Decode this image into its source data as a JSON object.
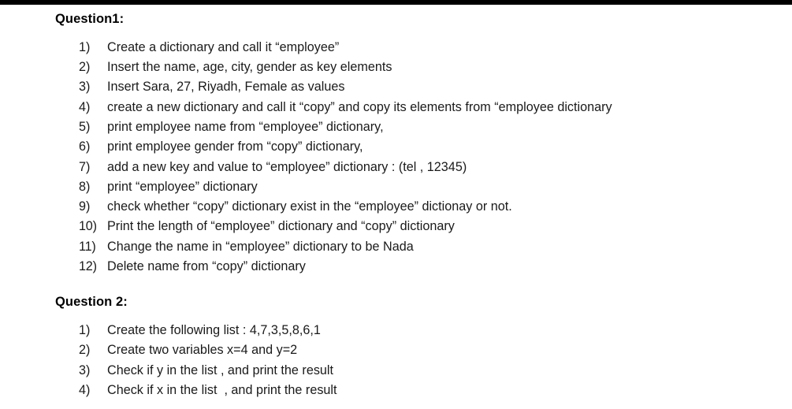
{
  "document": {
    "top_bar_color": "#000000",
    "background_color": "#ffffff",
    "text_color": "#1a1a1a"
  },
  "questions": [
    {
      "heading": "Question1:",
      "items": [
        {
          "marker": "1)",
          "text": "Create a dictionary and call it “employee”"
        },
        {
          "marker": "2)",
          "text": "Insert the name, age, city, gender as key elements"
        },
        {
          "marker": "3)",
          "text": "Insert Sara, 27, Riyadh, Female as values"
        },
        {
          "marker": "4)",
          "text": "create a new dictionary and call it “copy” and copy its elements from “employee dictionary"
        },
        {
          "marker": "5)",
          "text": "print employee name from “employee” dictionary,"
        },
        {
          "marker": "6)",
          "text": "print employee gender from “copy” dictionary,"
        },
        {
          "marker": "7)",
          "text": "add a new key and value to “employee” dictionary : (tel , 12345)"
        },
        {
          "marker": "8)",
          "text": "print “employee” dictionary"
        },
        {
          "marker": "9)",
          "text": "check whether “copy” dictionary exist in the “employee” dictionay or not."
        },
        {
          "marker": "10)",
          "text": "Print the length of “employee” dictionary and “copy” dictionary"
        },
        {
          "marker": "11)",
          "text": "Change the name in “employee” dictionary to be Nada"
        },
        {
          "marker": "12)",
          "text": "Delete name from “copy” dictionary"
        }
      ]
    },
    {
      "heading": "Question 2:",
      "items": [
        {
          "marker": "1)",
          "text": "Create the following list : 4,7,3,5,8,6,1"
        },
        {
          "marker": "2)",
          "text": "Create two variables x=4 and y=2"
        },
        {
          "marker": "3)",
          "text": "Check if y in the list , and print the result"
        },
        {
          "marker": "4)",
          "text": "Check if x in the list  , and print the result"
        }
      ]
    }
  ]
}
